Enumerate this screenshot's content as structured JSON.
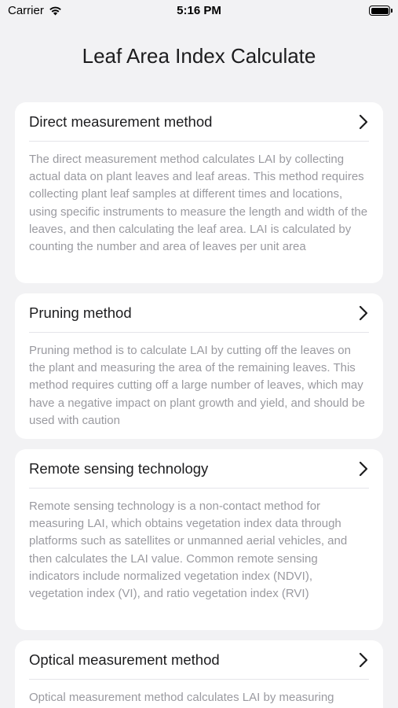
{
  "status": {
    "carrier": "Carrier",
    "time": "5:16 PM"
  },
  "header": {
    "title": "Leaf Area Index Calculate"
  },
  "cards": [
    {
      "title": "Direct measurement method",
      "description": "The direct measurement method calculates LAI by collecting actual data on plant leaves and leaf areas. This method requires collecting plant leaf samples at different times and locations, using specific instruments to measure the length and width of the leaves, and then calculating the leaf area. LAI is calculated by counting the number and area of leaves per unit area"
    },
    {
      "title": "Pruning method",
      "description": "Pruning method is to calculate LAI by cutting off the leaves on the plant and measuring the area of the remaining leaves. This method requires cutting off a large number of leaves, which may have a negative impact on plant growth and yield, and should be used with caution"
    },
    {
      "title": "Remote sensing technology",
      "description": "Remote sensing technology is a non-contact method for measuring LAI, which obtains vegetation index data through platforms such as satellites or unmanned aerial vehicles, and then calculates the LAI value. Common remote sensing indicators include normalized vegetation index (NDVI), vegetation index (VI), and ratio vegetation index (RVI)"
    },
    {
      "title": "Optical measurement method",
      "description": "Optical measurement method calculates LAI by measuring"
    }
  ]
}
